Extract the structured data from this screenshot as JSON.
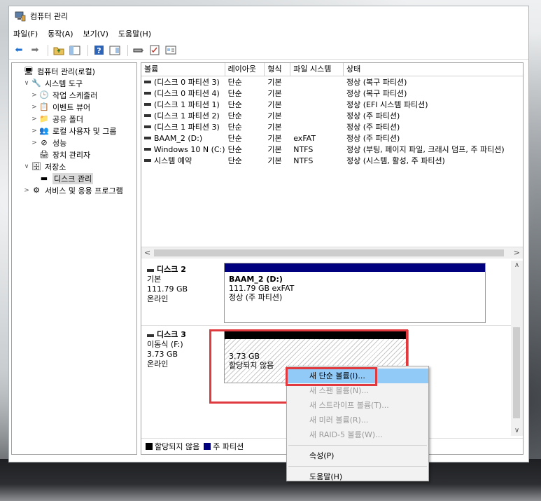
{
  "window": {
    "title": "컴퓨터 관리",
    "menu": [
      "파일(F)",
      "동작(A)",
      "보기(V)",
      "도움말(H)"
    ]
  },
  "tree": [
    {
      "label": "컴퓨터 관리(로컬)",
      "indent": 0,
      "chev": "",
      "icon": "computer-management-icon"
    },
    {
      "label": "시스템 도구",
      "indent": 1,
      "chev": "∨",
      "icon": "system-tools-icon"
    },
    {
      "label": "작업 스케줄러",
      "indent": 2,
      "chev": ">",
      "icon": "clock-icon"
    },
    {
      "label": "이벤트 뷰어",
      "indent": 2,
      "chev": ">",
      "icon": "event-viewer-icon"
    },
    {
      "label": "공유 폴더",
      "indent": 2,
      "chev": ">",
      "icon": "shared-folder-icon"
    },
    {
      "label": "로컬 사용자 및 그룹",
      "indent": 2,
      "chev": ">",
      "icon": "users-icon"
    },
    {
      "label": "성능",
      "indent": 2,
      "chev": ">",
      "icon": "performance-icon"
    },
    {
      "label": "장치 관리자",
      "indent": 2,
      "chev": "",
      "icon": "device-manager-icon"
    },
    {
      "label": "저장소",
      "indent": 1,
      "chev": "∨",
      "icon": "storage-icon"
    },
    {
      "label": "디스크 관리",
      "indent": 2,
      "chev": "",
      "icon": "disk-icon",
      "selected": true
    },
    {
      "label": "서비스 및 응용 프로그램",
      "indent": 1,
      "chev": ">",
      "icon": "services-icon"
    }
  ],
  "volume_table": {
    "headers": [
      "볼륨",
      "레이아웃",
      "형식",
      "파일 시스템",
      "상태"
    ],
    "rows": [
      [
        "(디스크 0 파티션 3)",
        "단순",
        "기본",
        "",
        "정상 (복구 파티션)"
      ],
      [
        "(디스크 0 파티션 4)",
        "단순",
        "기본",
        "",
        "정상 (복구 파티션)"
      ],
      [
        "(디스크 1 파티션 1)",
        "단순",
        "기본",
        "",
        "정상 (EFI 시스템 파티션)"
      ],
      [
        "(디스크 1 파티션 2)",
        "단순",
        "기본",
        "",
        "정상 (주 파티션)"
      ],
      [
        "(디스크 1 파티션 3)",
        "단순",
        "기본",
        "",
        "정상 (주 파티션)"
      ],
      [
        "BAAM_2 (D:)",
        "단순",
        "기본",
        "exFAT",
        "정상 (주 파티션)"
      ],
      [
        "Windows 10 N (C:)",
        "단순",
        "기본",
        "NTFS",
        "정상 (부팅, 페이지 파일, 크래시 덤프, 주 파티션)"
      ],
      [
        "시스템 예약",
        "단순",
        "기본",
        "NTFS",
        "정상 (시스템, 활성, 주 파티션)"
      ]
    ]
  },
  "disks": {
    "disk2": {
      "name": "디스크 2",
      "type": "기본",
      "size": "111.79 GB",
      "status": "온라인",
      "partition": {
        "name": "BAAM_2  (D:)",
        "size": "111.79 GB exFAT",
        "status": "정상 (주 파티션)"
      }
    },
    "disk3": {
      "name": "디스크 3",
      "type": "이동식 (F:)",
      "size": "3.73 GB",
      "status": "온라인",
      "partition": {
        "size": "3.73 GB",
        "status": "할당되지 않음"
      }
    }
  },
  "legend": {
    "unallocated": "할당되지 않음",
    "primary": "주 파티션"
  },
  "context_menu": {
    "new_simple": "새 단순 볼륨(I)...",
    "new_spanned": "새 스팬 볼륨(N)...",
    "new_striped": "새 스트라이프 볼륨(T)...",
    "new_mirror": "새 미러 볼륨(R)...",
    "new_raid5": "새 RAID-5 볼륨(W)...",
    "properties": "속성(P)",
    "help": "도움말(H)"
  },
  "colors": {
    "highlight": "#91c9f7",
    "primary_partition": "#00007f",
    "unallocated": "#000000",
    "annotation_red": "#e03a3e"
  }
}
